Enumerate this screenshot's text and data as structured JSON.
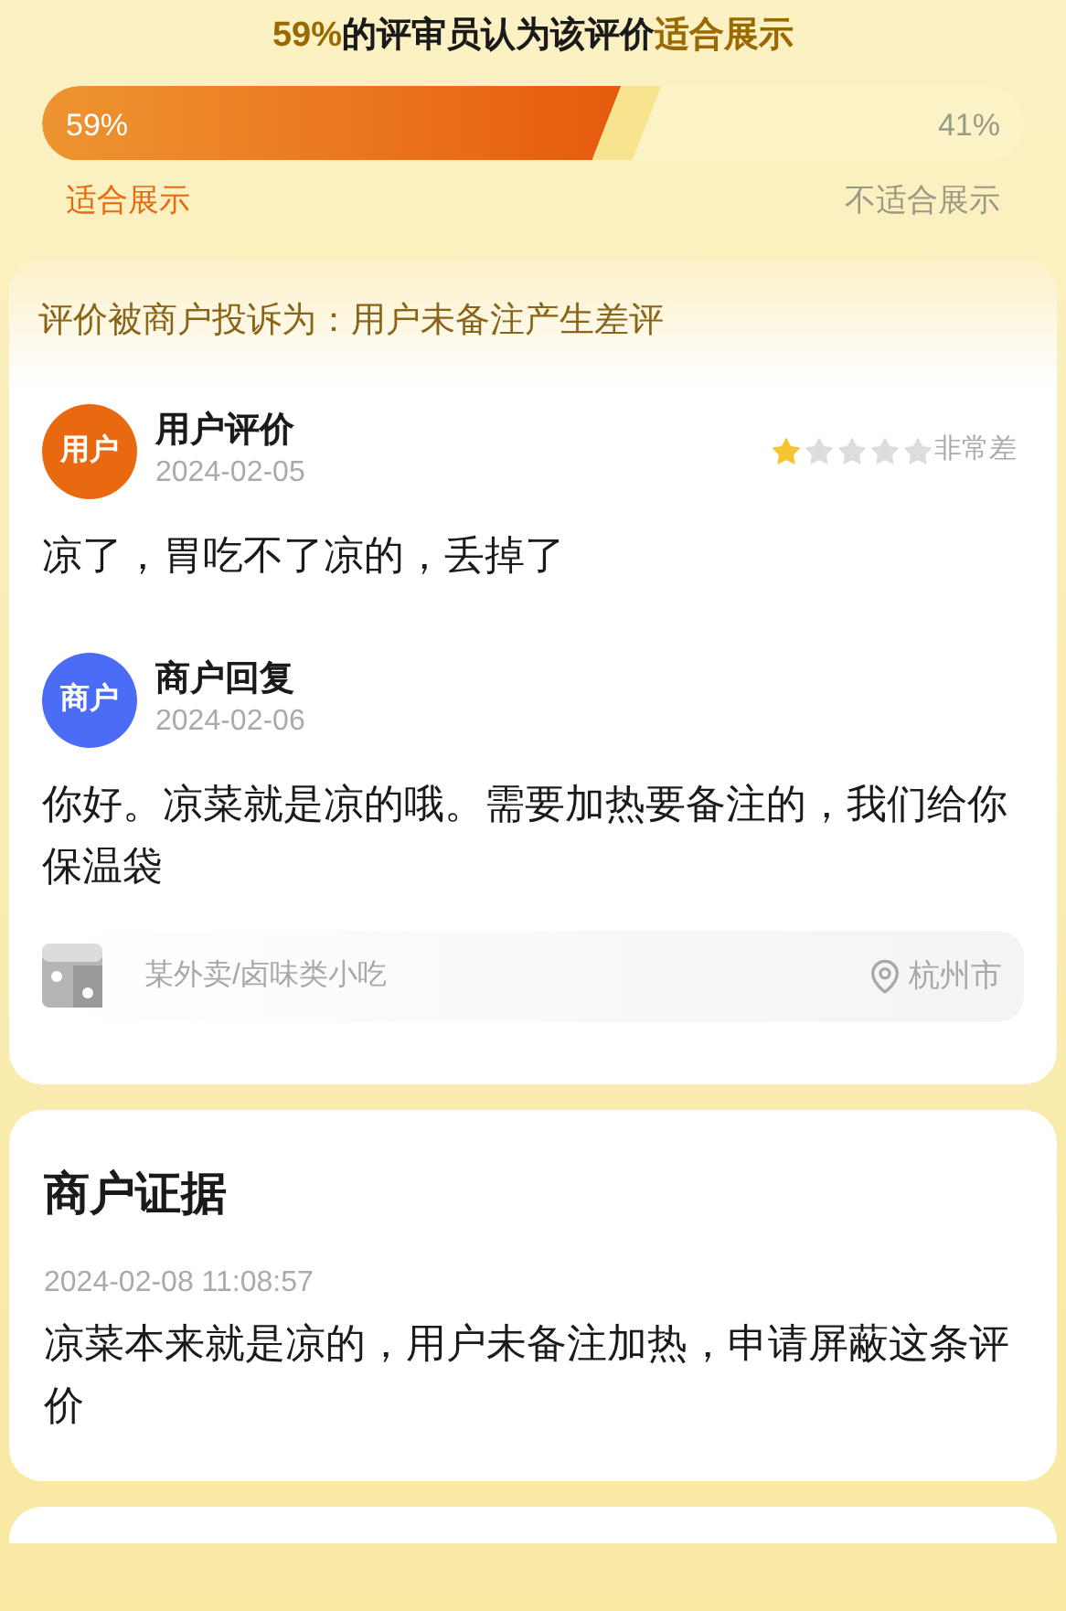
{
  "vote": {
    "title": "**59%**的评审员认为该评价**适合展示**",
    "level": 0.59,
    "left_reading": "59%",
    "right_reading": "41%",
    "left_label": "适合展示",
    "right_label": "不适合展示"
  },
  "complaint": {
    "heading": "评价被商户投诉为：用户未备注产生差评",
    "entries": [
      {
        "kind": "user",
        "avatar": "用户",
        "title": "用户评价",
        "date": "2024-02-05",
        "stars": 1,
        "rating_text": "非常差",
        "text": "凉了，胃吃不了凉的，丢掉了"
      },
      {
        "kind": "merchant",
        "avatar": "商户",
        "title": "商户回复",
        "date": "2024-02-06",
        "text": "你好。凉菜就是凉的哦。需要加热要备注的，我们给你保温袋"
      }
    ],
    "shop": {
      "category": "某外卖/卤味类小吃",
      "city": "杭州市"
    }
  },
  "evidence": {
    "heading": "商户证据",
    "time": "2024-02-08 11:08:57",
    "text": "凉菜本来就是凉的，用户未备注加热，申请屏蔽这条评价"
  }
}
